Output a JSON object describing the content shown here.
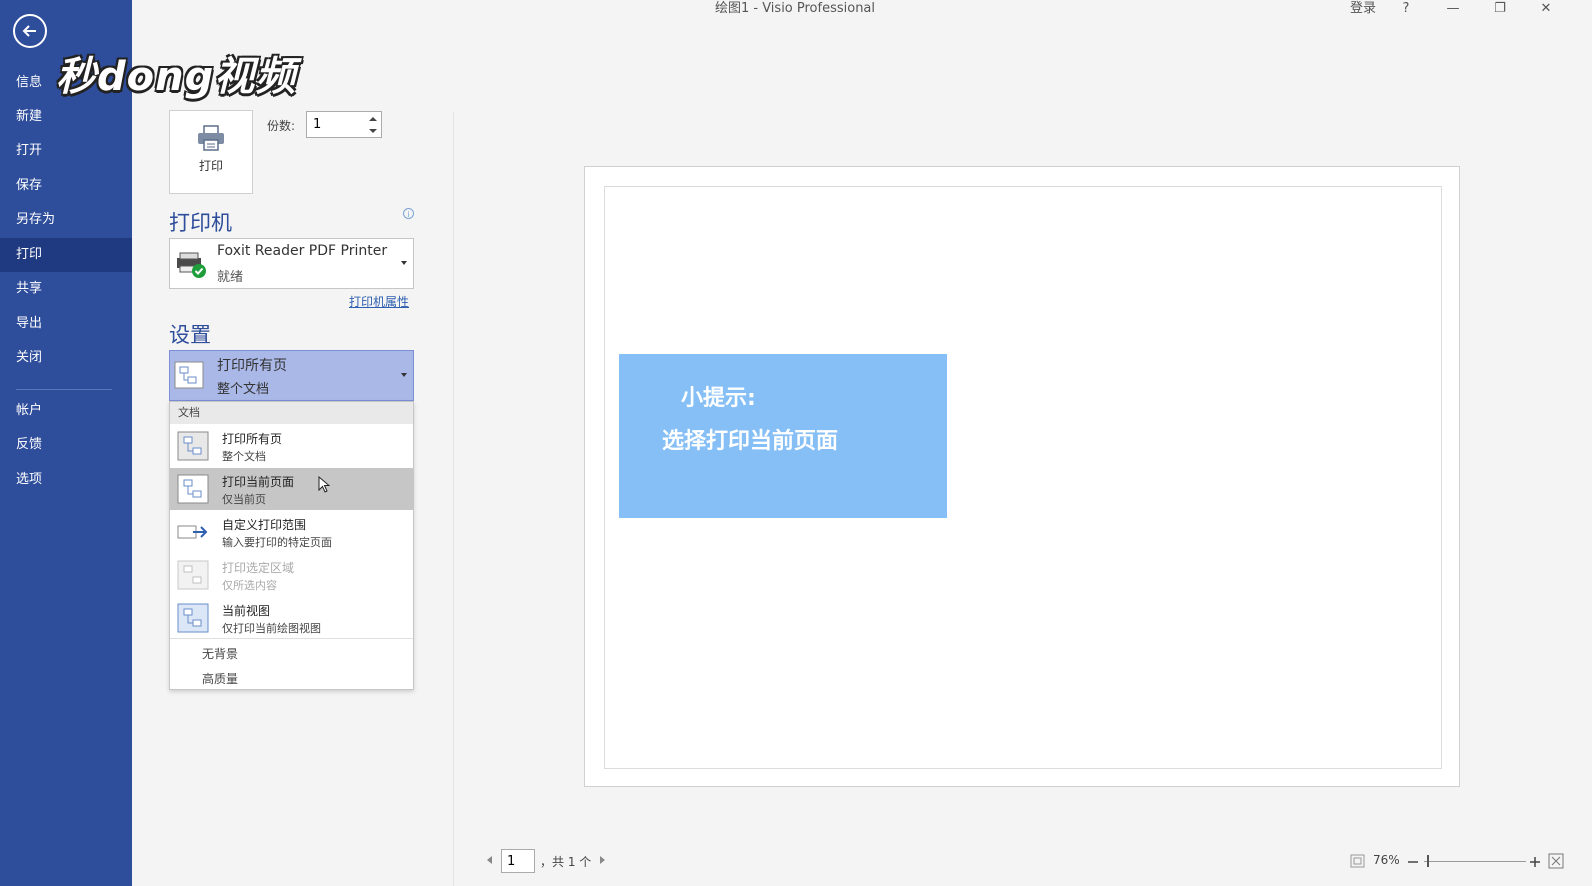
{
  "window": {
    "title": "绘图1  -  Visio Professional",
    "login": "登录",
    "help": "?",
    "minimize": "—",
    "restore": "❐",
    "close": "✕"
  },
  "watermark": "秒dong视频",
  "sidebar": {
    "items": [
      {
        "label": "信息"
      },
      {
        "label": "新建"
      },
      {
        "label": "打开"
      },
      {
        "label": "保存"
      },
      {
        "label": "另存为"
      },
      {
        "label": "打印",
        "active": true
      },
      {
        "label": "共享"
      },
      {
        "label": "导出"
      },
      {
        "label": "关闭"
      },
      {
        "label": "帐户"
      },
      {
        "label": "反馈"
      },
      {
        "label": "选项"
      }
    ]
  },
  "print": {
    "button_label": "打印",
    "copies_label": "份数:",
    "copies_value": "1"
  },
  "printer": {
    "heading": "打印机",
    "name": "Foxit Reader PDF Printer",
    "status": "就绪",
    "properties_link": "打印机属性"
  },
  "settings": {
    "heading": "设置",
    "selected_title": "打印所有页",
    "selected_sub": "整个文档"
  },
  "dropdown": {
    "header": "文档",
    "items": [
      {
        "title": "打印所有页",
        "sub": "整个文档"
      },
      {
        "title": "打印当前页面",
        "sub": "仅当前页",
        "highlighted": true
      },
      {
        "title": "自定义打印范围",
        "sub": "输入要打印的特定页面"
      },
      {
        "title": "打印选定区域",
        "sub": "仅所选内容",
        "disabled": true
      },
      {
        "title": "当前视图",
        "sub": "仅打印当前绘图视图"
      }
    ],
    "options": [
      "无背景",
      "高质量"
    ]
  },
  "preview": {
    "tip_title": "小提示:",
    "tip_body": "选择打印当前页面"
  },
  "footer": {
    "page_value": "1",
    "page_total": "，共 1 个",
    "zoom": "76%"
  },
  "colors": {
    "sidebar": "#2e4d9b",
    "sidebar_active": "#1f3a80",
    "accent": "#2e4d9b",
    "tip_box": "#85bff6",
    "selected_range": "#aab8e8"
  }
}
